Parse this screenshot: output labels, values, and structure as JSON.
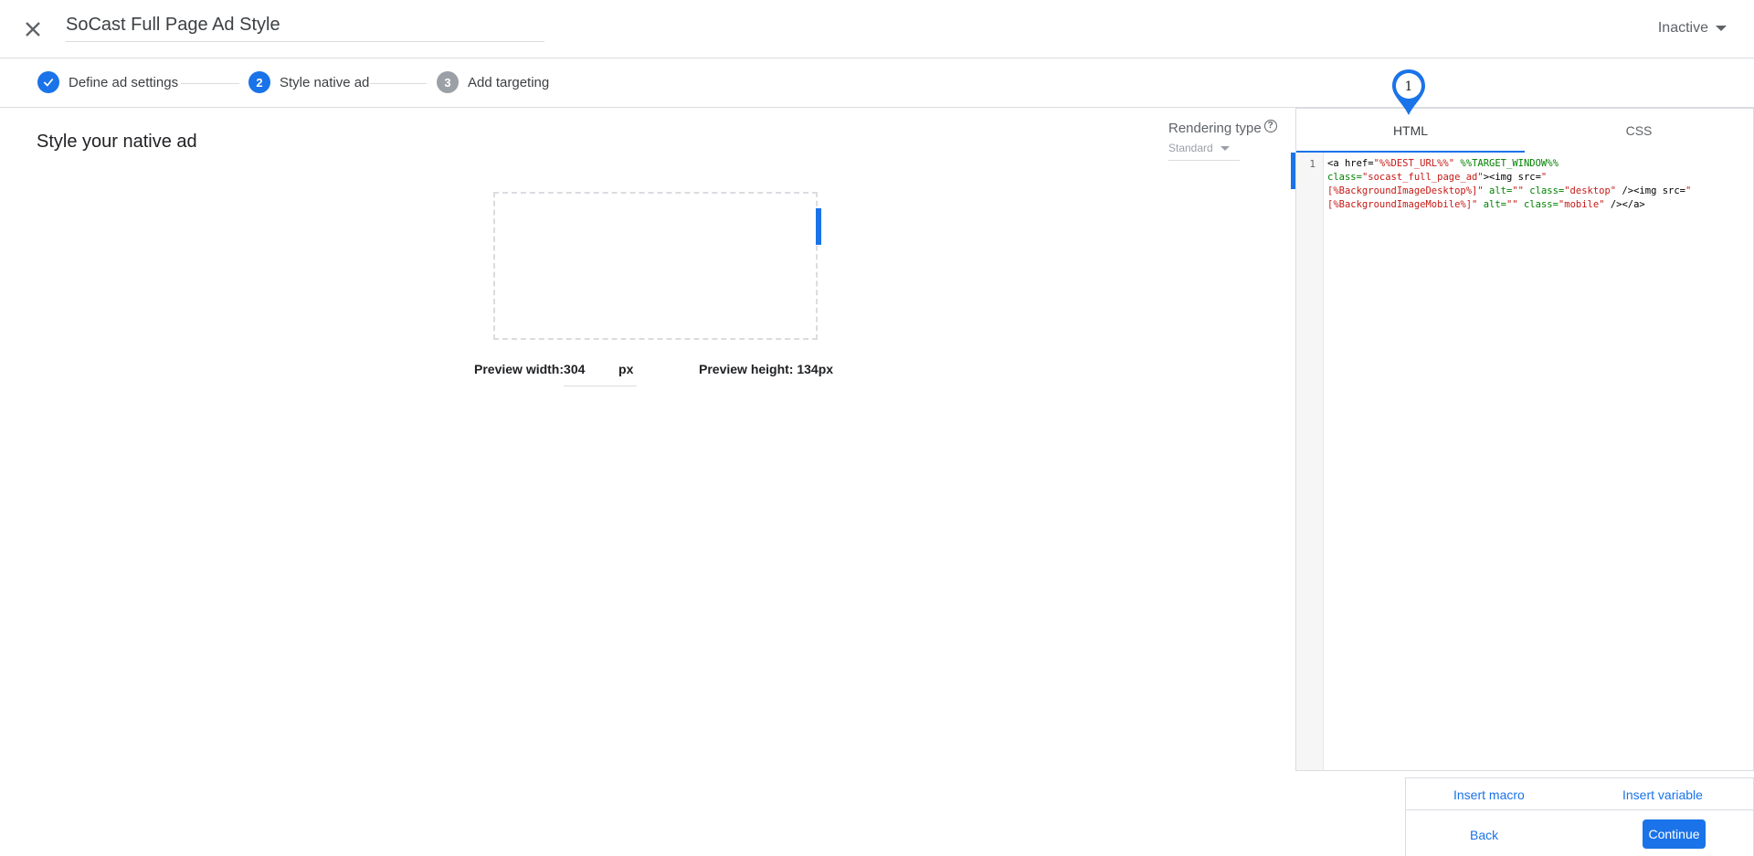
{
  "header": {
    "title": "SoCast Full Page Ad Style",
    "status": "Inactive"
  },
  "stepper": {
    "steps": [
      {
        "number": "",
        "label": "Define ad settings",
        "state": "done"
      },
      {
        "number": "2",
        "label": "Style native ad",
        "state": "active"
      },
      {
        "number": "3",
        "label": "Add targeting",
        "state": "todo"
      }
    ]
  },
  "main": {
    "heading": "Style your native ad",
    "rendering_label": "Rendering type",
    "rendering_value": "Standard",
    "preview_width_label": "Preview width:",
    "preview_width_value": "304",
    "preview_width_unit": "px",
    "preview_height_label": "Preview height: 134px"
  },
  "editor": {
    "tabs": [
      "HTML",
      "CSS"
    ],
    "active_tab": "HTML",
    "line_number": "1",
    "badge_number": "1"
  },
  "actions": {
    "insert_macro": "Insert macro",
    "insert_variable": "Insert variable",
    "back": "Back",
    "continue": "Continue"
  },
  "colors": {
    "accent": "#1a73e8",
    "inactive_step": "#9aa0a6"
  }
}
